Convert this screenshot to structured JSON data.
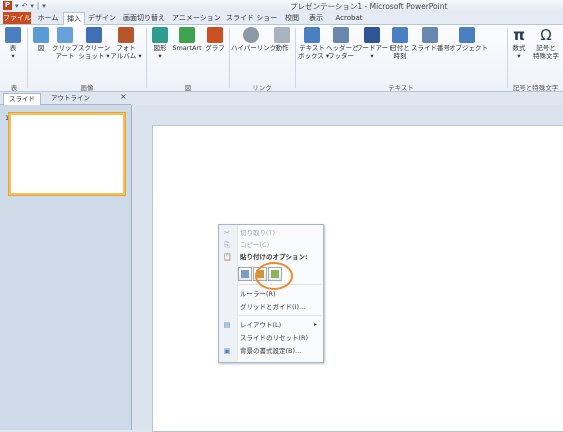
{
  "window": {
    "title": "プレゼンテーション1 - Microsoft PowerPoint",
    "app_logo_text": "P",
    "qat": [
      "▾",
      "↶",
      "▾",
      "|",
      "▾"
    ]
  },
  "tabs": [
    {
      "label": "ファイル",
      "active": false,
      "file": true
    },
    {
      "label": "ホーム",
      "active": false
    },
    {
      "label": "挿入",
      "active": true
    },
    {
      "label": "デザイン",
      "active": false
    },
    {
      "label": "画面切り替え",
      "active": false
    },
    {
      "label": "アニメーション",
      "active": false
    },
    {
      "label": "スライド ショー",
      "active": false
    },
    {
      "label": "校閲",
      "active": false
    },
    {
      "label": "表示",
      "active": false
    },
    {
      "label": "Acrobat",
      "active": false
    }
  ],
  "ribbon": {
    "buttons": [
      {
        "label": "表\n▾",
        "icon": "table-icon",
        "color": "#4a7fc1"
      },
      {
        "label": "図",
        "icon": "picture-icon",
        "color": "#5b9bd5"
      },
      {
        "label": "クリップ\nアート",
        "icon": "clipart-icon",
        "color": "#6aa0d8"
      },
      {
        "label": "スクリーン\nショット ▾",
        "icon": "screenshot-icon",
        "color": "#3f6fb5"
      },
      {
        "label": "フォト\nアルバム ▾",
        "icon": "photo-album-icon",
        "color": "#b5572b"
      },
      {
        "label": "図形\n▾",
        "icon": "shapes-icon",
        "color": "#2e9c8f"
      },
      {
        "label": "SmartArt",
        "icon": "smartart-icon",
        "color": "#3fa34d"
      },
      {
        "label": "グラフ",
        "icon": "chart-icon",
        "color": "#c9501f"
      },
      {
        "label": "ハイパーリンク",
        "icon": "hyperlink-icon",
        "color": "#8d98a6"
      },
      {
        "label": "動作",
        "icon": "action-icon",
        "color": "#a9b3bf"
      },
      {
        "label": "テキスト\nボックス ▾",
        "icon": "textbox-icon",
        "color": "#4a7fc1"
      },
      {
        "label": "ヘッダーと\nフッター",
        "icon": "header-footer-icon",
        "color": "#6a87b0"
      },
      {
        "label": "ワードアート\n▾",
        "icon": "wordart-icon",
        "color": "#2f5597"
      },
      {
        "label": "日付と\n時刻",
        "icon": "date-time-icon",
        "color": "#4a7fc1"
      },
      {
        "label": "スライド番号",
        "icon": "slide-number-icon",
        "color": "#6a87b0"
      },
      {
        "label": "オブジェクト",
        "icon": "object-icon",
        "color": "#4a7fc1"
      },
      {
        "label": "数式\n▾",
        "icon": "equation-icon",
        "color": "#2d3e57"
      },
      {
        "label": "記号と\n特殊文字",
        "icon": "symbol-icon",
        "color": "#2d3e57"
      }
    ],
    "groups": [
      "表",
      "画像",
      "図",
      "リンク",
      "テキスト",
      "記号と特殊文字"
    ]
  },
  "panel": {
    "tabs": [
      "スライド",
      "アウトライン"
    ],
    "close": "×",
    "slide_number": "1"
  },
  "context_menu": {
    "items": [
      {
        "label": "切り取り(T)",
        "icon": "✂",
        "icon_name": "cut-icon",
        "disabled": true
      },
      {
        "label": "コピー(C)",
        "icon": "⎘",
        "icon_name": "copy-icon",
        "disabled": true
      },
      {
        "label": "貼り付けのオプション:",
        "icon": "📋",
        "icon_name": "paste-icon",
        "disabled": false
      },
      {
        "label": "ルーラー(R)",
        "icon": "",
        "icon_name": "",
        "disabled": false
      },
      {
        "label": "グリッドとガイド(I)...",
        "icon": "",
        "icon_name": "",
        "disabled": false
      },
      {
        "label": "レイアウト(L)",
        "icon": "▤",
        "icon_name": "layout-icon",
        "disabled": false,
        "submenu": "▸"
      },
      {
        "label": "スライドのリセット(R)",
        "icon": "",
        "icon_name": "",
        "disabled": false
      },
      {
        "label": "背景の書式設定(B)...",
        "icon": "▣",
        "icon_name": "format-background-icon",
        "disabled": false
      }
    ]
  },
  "colors": {
    "file_tab": "#c84b1f",
    "thumb_border": "#f1c25a",
    "highlight": "#f28a2a"
  }
}
